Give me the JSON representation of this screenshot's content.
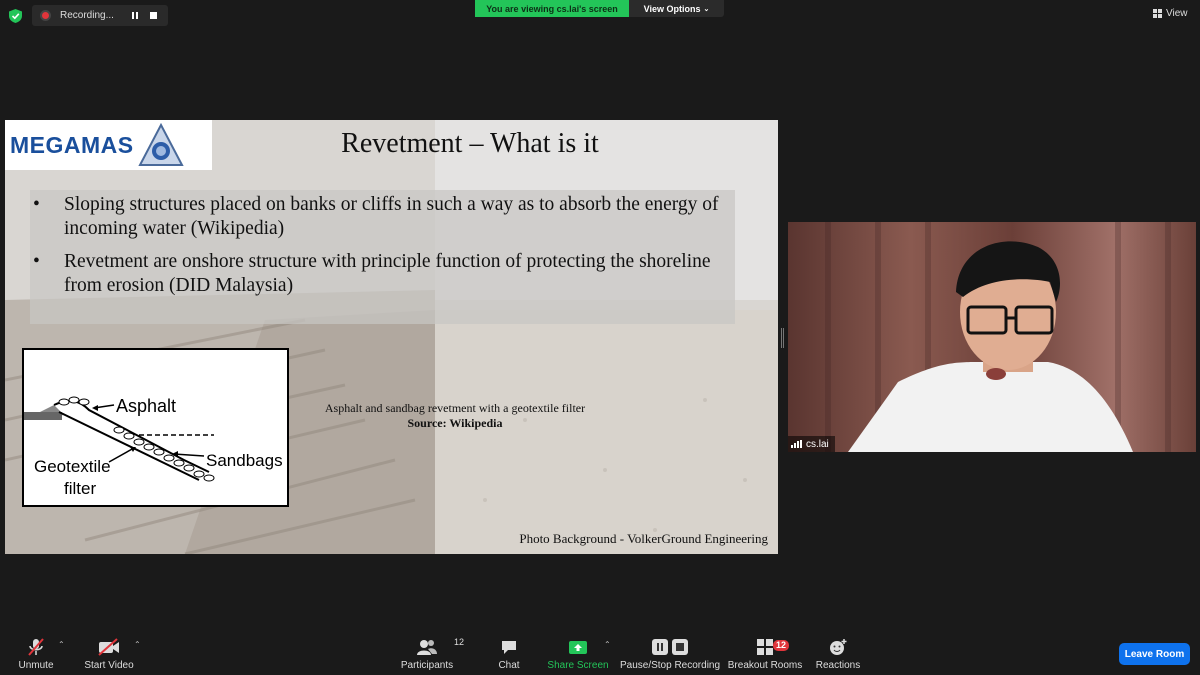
{
  "top_bar": {
    "recording_label": "Recording...",
    "viewing_banner": "You are viewing cs.lai's screen",
    "view_options_label": "View Options",
    "view_label": "View"
  },
  "slide": {
    "logo_text": "MEGAMAS",
    "title": "Revetment – What is it",
    "bullets": [
      "Sloping structures placed on banks or cliffs in such a way as to absorb the energy of incoming water (Wikipedia)",
      "Revetment are onshore structure with principle function of protecting the shoreline from erosion (DID Malaysia)"
    ],
    "diagram_labels": {
      "asphalt": "Asphalt",
      "sandbags": "Sandbags",
      "geotextile_line1": "Geotextile",
      "geotextile_line2": "filter"
    },
    "caption": "Asphalt and sandbag revetment with a geotextile filter",
    "source": "Source: Wikipedia",
    "photo_credit": "Photo Background - VolkerGround Engineering"
  },
  "video": {
    "participant_name": "cs.lai"
  },
  "toolbar": {
    "unmute": "Unmute",
    "start_video": "Start Video",
    "participants": "Participants",
    "participants_count": "12",
    "chat": "Chat",
    "share_screen": "Share Screen",
    "pause_stop_recording": "Pause/Stop Recording",
    "breakout_rooms": "Breakout Rooms",
    "breakout_badge": "12",
    "reactions": "Reactions",
    "leave_room": "Leave Room"
  },
  "colors": {
    "background": "#1a1a1a",
    "viewing_banner": "#23c559",
    "leave_button": "#0e72ed",
    "recording_dot": "#e0353b",
    "share_green": "#23c559"
  }
}
